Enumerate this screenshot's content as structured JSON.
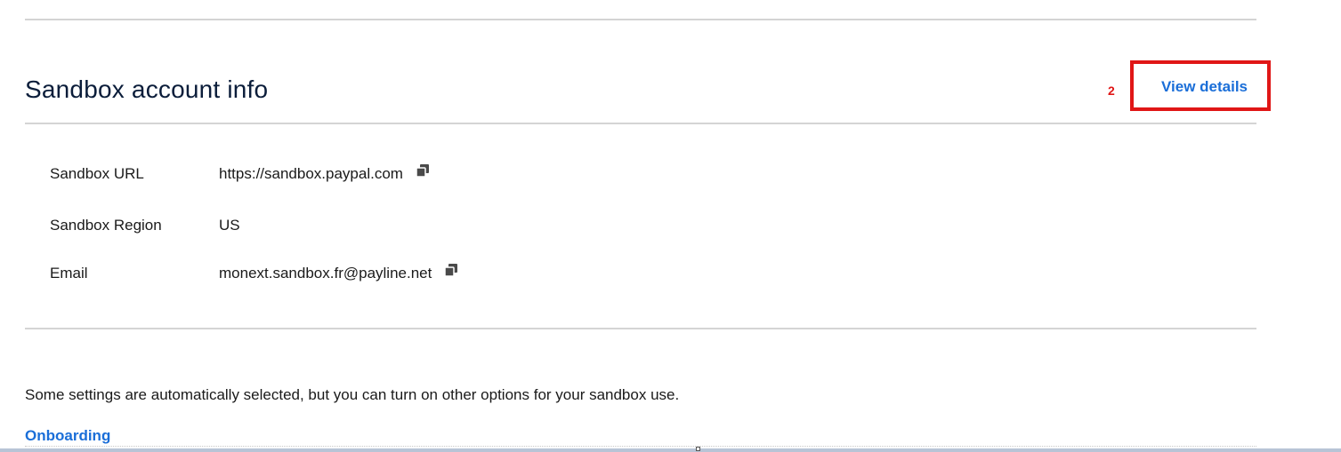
{
  "section": {
    "title": "Sandbox account info",
    "view_details_label": "View details",
    "annotation_number": "2"
  },
  "info": {
    "rows": [
      {
        "label": "Sandbox URL",
        "value": "https://sandbox.paypal.com",
        "copyable": true
      },
      {
        "label": "Sandbox Region",
        "value": "US",
        "copyable": false
      },
      {
        "label": "Email",
        "value": "monext.sandbox.fr@payline.net",
        "copyable": true
      }
    ]
  },
  "settings": {
    "description": "Some settings are automatically selected, but you can turn on other options for your sandbox use.",
    "onboarding_label": "Onboarding"
  },
  "colors": {
    "link": "#1a6ed8",
    "annotation": "#e01616",
    "title": "#0b1d3a"
  },
  "icons": {
    "copy": "copy-icon"
  }
}
